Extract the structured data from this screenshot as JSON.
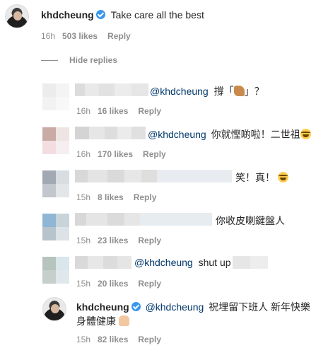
{
  "main_comment": {
    "username": "khdcheung",
    "text": "Take care all the best",
    "time": "16h",
    "likes": "503 likes",
    "reply": "Reply"
  },
  "hide_replies": "Hide replies",
  "replies": [
    {
      "mention": "@khdcheung",
      "text": "撐「",
      "text_after": "」？",
      "emoji": "horse-emoji",
      "time": "16h",
      "likes": "16 likes",
      "reply": "Reply"
    },
    {
      "mention": "@khdcheung",
      "text": "你就慳啲啦！二世祖",
      "emoji": "laughing-tears-emoji",
      "time": "16h",
      "likes": "170 likes",
      "reply": "Reply"
    },
    {
      "text": "笑！真！",
      "emoji": "laughing-tears-emoji",
      "time": "15h",
      "likes": "8 likes",
      "reply": "Reply"
    },
    {
      "text": "你收皮喇鍵盤人",
      "time": "15h",
      "likes": "23 likes",
      "reply": "Reply"
    },
    {
      "mention": "@khdcheung",
      "text": "shut up",
      "time": "15h",
      "likes": "20 likes",
      "reply": "Reply"
    }
  ],
  "final_reply": {
    "username": "khdcheung",
    "mention": "@khdcheung",
    "text_line1": "祝埋留下班人 新年快樂",
    "text_line2": "身體健康",
    "emoji": "folded-hands-emoji",
    "time": "15h",
    "likes": "82 likes",
    "reply": "Reply"
  },
  "colors": {
    "text": "#262626",
    "secondary": "#8e8e8e",
    "mention": "#00376b",
    "verified": "#3897f0"
  }
}
